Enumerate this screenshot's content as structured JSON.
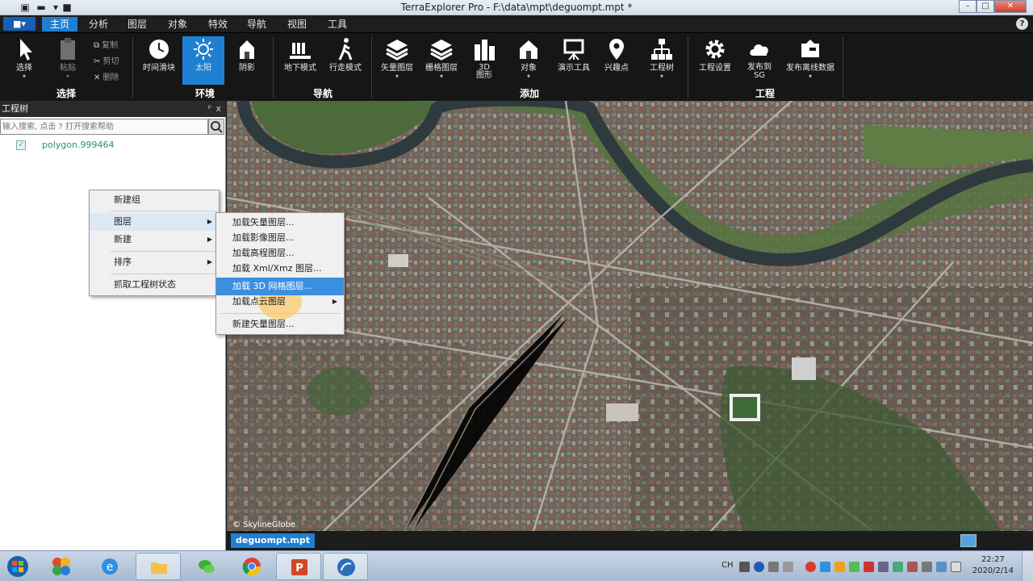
{
  "window": {
    "title": "TerraExplorer Pro - F:\\data\\mpt\\deguompt.mpt *",
    "controls": [
      "minimize",
      "maximize",
      "close"
    ]
  },
  "menubar": {
    "app_button": "■▾",
    "tabs": [
      "主页",
      "分析",
      "图层",
      "对象",
      "特效",
      "导航",
      "视图",
      "工具"
    ],
    "active_tab": "主页",
    "help": "?"
  },
  "ribbon": {
    "select_group": {
      "label": "选择",
      "select": "选择",
      "paste": "粘贴",
      "copy": "复制",
      "cut": "剪切",
      "delete": "删除"
    },
    "environment_group": {
      "label": "环境",
      "time_slider": "时间滑块",
      "sun": "太阳",
      "shadow": "阴影"
    },
    "navigation_group": {
      "label": "导航",
      "underground": "地下模式",
      "walk": "行走模式"
    },
    "add_group": {
      "label": "添加",
      "vector_layer": "矢量图层",
      "raster_layer": "栅格图层",
      "3d_mesh": "3D",
      "3d_mesh_2": "图形",
      "object": "对象",
      "presentation": "演示工具",
      "poi": "兴趣点",
      "project_tree": "工程树"
    },
    "project_group": {
      "label": "工程",
      "settings": "工程设置",
      "publish": "发布到",
      "publish_2": "SG",
      "offline": "发布离线数据"
    }
  },
  "panel": {
    "title": "工程树",
    "pin": "ᵖ",
    "close": "x",
    "search_placeholder": "输入搜索, 点击 ? 打开搜索帮助",
    "tree_item": "polygon.999464"
  },
  "context_menu": {
    "items": [
      "新建组",
      "图层",
      "新建",
      "排序",
      "抓取工程树状态"
    ]
  },
  "submenu": {
    "items": [
      "加载矢量图层...",
      "加载影像图层...",
      "加载高程图层...",
      "加载 Xml/Xmz 图层...",
      "加载 3D 网格图层...",
      "加载点云图层",
      "新建矢量图层..."
    ],
    "highlighted": "加载 3D 网格图层..."
  },
  "map": {
    "attribution": "© SkylineGlobe",
    "document_tab": "deguompt.mpt"
  },
  "taskbar": {
    "time": "22:27",
    "date": "2020/2/14",
    "lang": "CH"
  }
}
